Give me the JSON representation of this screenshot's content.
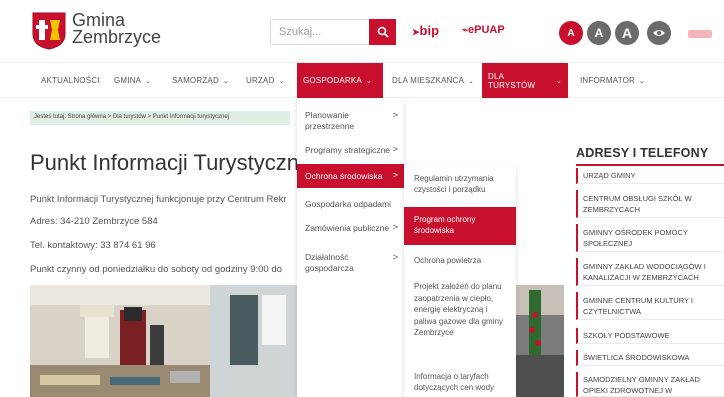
{
  "header": {
    "logo_line1": "Gmina",
    "logo_line2": "Zembrzyce",
    "search_placeholder": "Szukaj...",
    "bip_label": "bip",
    "epuap_label": "ePUAP",
    "accessibility": [
      "A",
      "A",
      "A"
    ],
    "brand_color": "#c8102e"
  },
  "nav": {
    "items": [
      {
        "label": "AKTUALNOŚCI",
        "chevron": ""
      },
      {
        "label": "GMINA",
        "chevron": "⌄"
      },
      {
        "label": "SAMORZĄD",
        "chevron": "⌄"
      },
      {
        "label": "URZĄD",
        "chevron": "⌄"
      },
      {
        "label": "GOSPODARKA",
        "chevron": "⌄"
      },
      {
        "label": "DLA MIESZKAŃCA",
        "chevron": "⌄"
      },
      {
        "label": "DLA TURYSTÓW",
        "chevron": "⌄"
      },
      {
        "label": "INFORMATOR",
        "chevron": "⌄"
      }
    ]
  },
  "breadcrumb": "Jesteś tutaj:  Strona główna  >  Dla turystów  >  Punkt Informacji turystycznej",
  "main": {
    "title": "Punkt Informacji Turystyczn",
    "lines": [
      "Punkt Informacji Turystycznej funkcjonuje przy Centrum Rekr",
      "Adres: 34-210 Zembrzyce 584",
      "Tel. kontaktowy: 33 874 61 96",
      "Punkt czynny od poniedziałku do soboty od godziny 9:00 do"
    ]
  },
  "dropdown_gospodarka": {
    "items": [
      {
        "label": "Planowanie przestrzenne",
        "arrow": ">"
      },
      {
        "label": "Programy strategiczne",
        "arrow": ">"
      },
      {
        "label": "Ochrona środowiska",
        "arrow": ">"
      },
      {
        "label": "Gospodarka odpadami",
        "arrow": ""
      },
      {
        "label": "Zamówienia publiczne",
        "arrow": ">"
      },
      {
        "label": "Działalność gospodarcza",
        "arrow": ">"
      }
    ]
  },
  "dropdown_ochrona": {
    "items": [
      {
        "label": "Regulamin utrzymania czystości i porządku"
      },
      {
        "label": "Program ochrony środowiska"
      },
      {
        "label": "Ochrona powietrza"
      },
      {
        "label": "Projekt założeń do planu zaopatrzenia w ciepło, energię elektryczną i paliwa gazowe dla gminy Zembrzyce"
      },
      {
        "label": "Informacja o taryfach dotyczących cen wody"
      }
    ]
  },
  "sidebar": {
    "title": "ADRESY I TELEFONY",
    "items": [
      "URZĄD GMINY",
      "CENTRUM OBSŁUGI SZKÓŁ W ZEMBRZYCACH",
      "GMINNY OŚRODEK POMOCY SPOŁECZNEJ",
      "GMINNY ZAKŁAD WODOCIĄGÓW I KANALIZACJI W ZEMBRZYCACH",
      "GMINNE CENTRUM KULTURY I CZYTELNICTWA",
      "SZKOŁY PODSTAWOWE",
      "ŚWIETLICA ŚRODOWISKOWA",
      "SAMODZIELNY GMINNY ZAKŁAD OPIEKI ZDROWOTNEJ W"
    ]
  }
}
